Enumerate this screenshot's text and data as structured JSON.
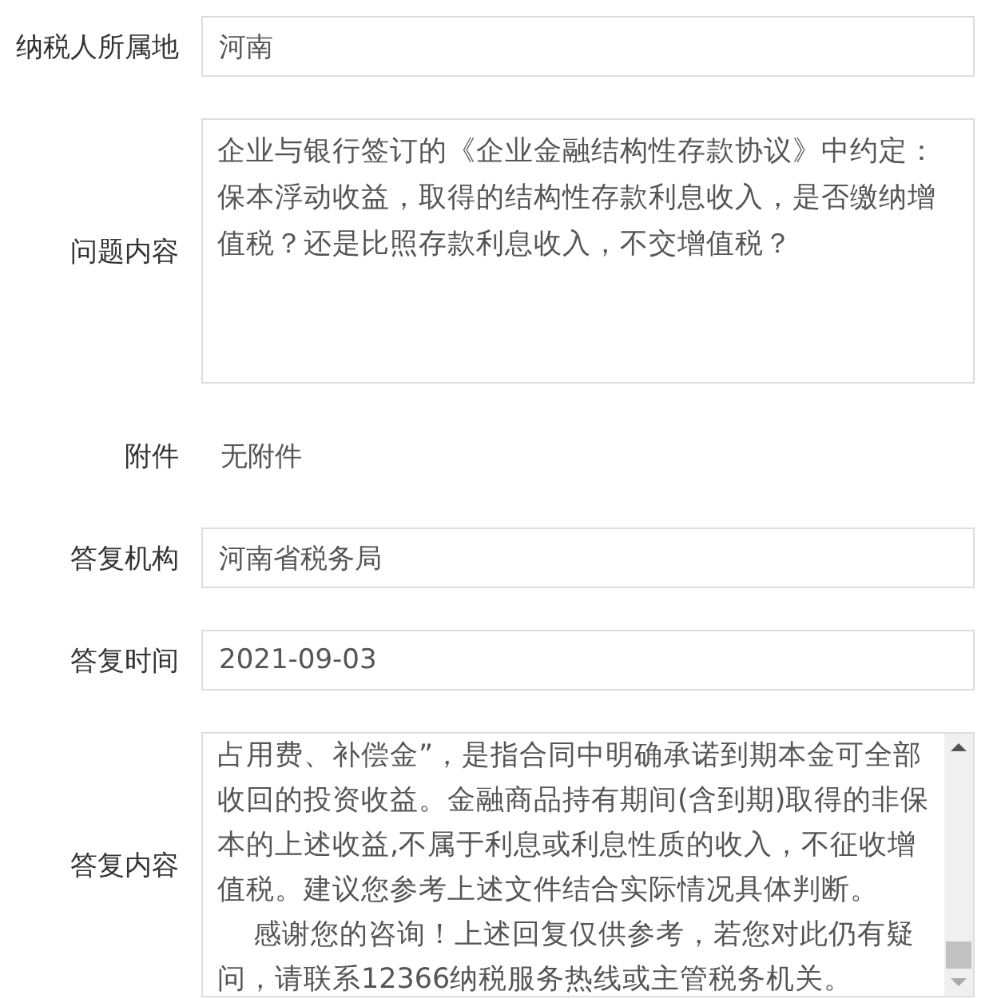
{
  "fields": [
    {
      "kind": "input",
      "label": "纳税人所属地",
      "value": "河南"
    },
    {
      "kind": "textarea",
      "label": "问题内容",
      "paragraphs": [
        "企业与银行签订的《企业金融结构性存款协议》中约定：保本浮动收益，取得的结构性存款利息收入，是否缴纳增值税？还是比照存款利息收入，不交增值税？"
      ]
    },
    {
      "kind": "plain",
      "label": "附件",
      "value": "无附件"
    },
    {
      "kind": "input",
      "label": "答复机构",
      "value": "河南省税务局"
    },
    {
      "kind": "input",
      "label": "答复时间",
      "value": "2021-09-03"
    },
    {
      "kind": "scroll",
      "label": "答复内容",
      "paragraphs": [
        "占用费、补偿金”，是指合同中明确承诺到期本金可全部收回的投资收益。金融商品持有期间(含到期)取得的非保本的上述收益,不属于利息或利息性质的收入，不征收增值税。建议您参考上述文件结合实际情况具体判断。",
        "    感谢您的咨询！上述回复仅供参考，若您对此仍有疑问，请联系12366纳税服务热线或主管税务机关。"
      ]
    }
  ]
}
